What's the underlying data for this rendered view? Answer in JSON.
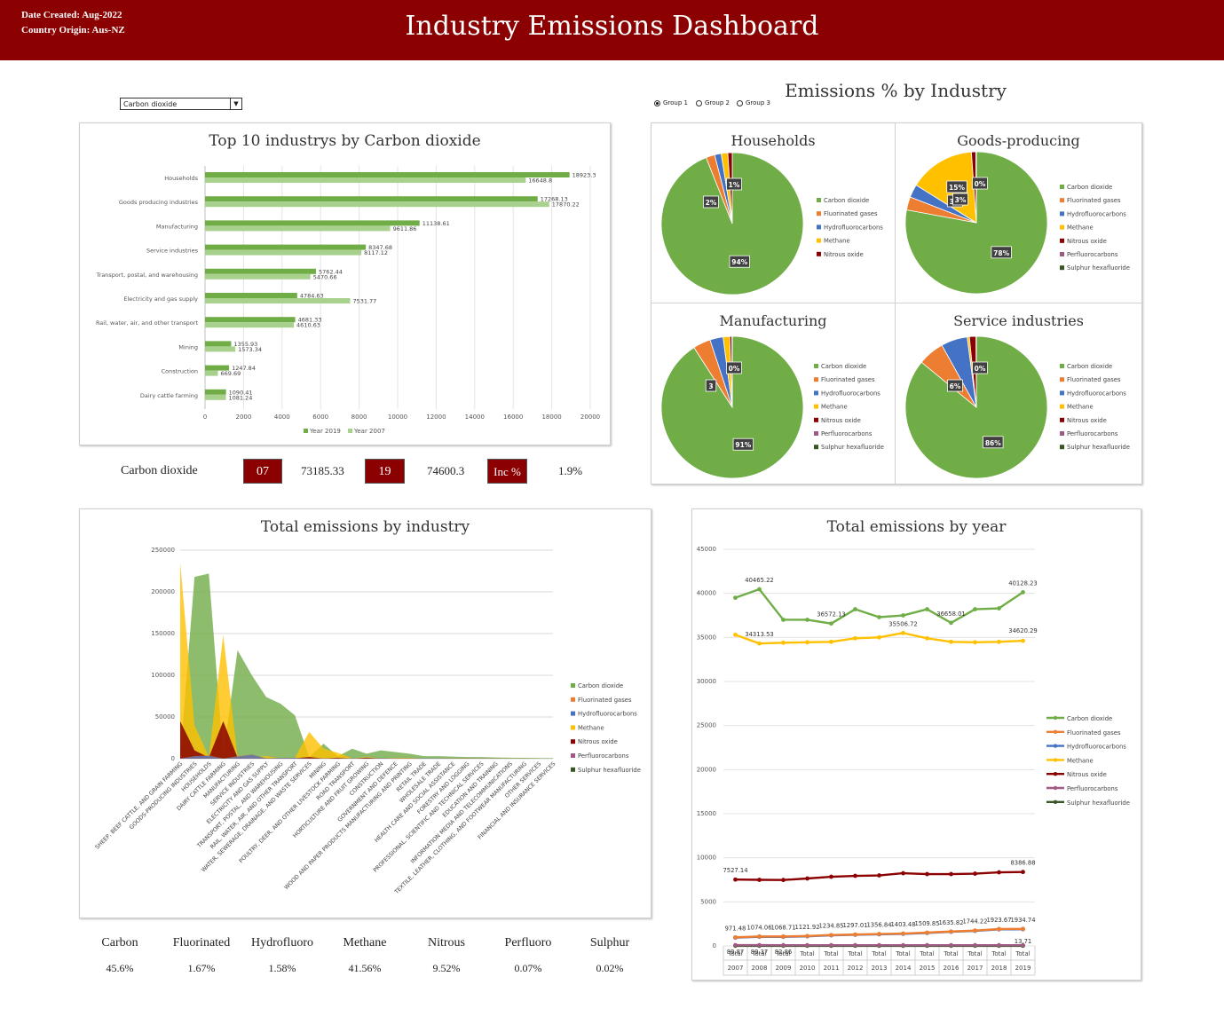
{
  "header": {
    "date_created": "Date Created: Aug-2022",
    "country_origin": "Country Origin: Aus-NZ",
    "title": "Industry Emissions Dashboard"
  },
  "controls": {
    "dropdown_value": "Carbon dioxide",
    "radio_options": [
      "Group 1",
      "Group 2",
      "Group 3"
    ],
    "radio_selected": "Group 1"
  },
  "kpi": {
    "gas": "Carbon dioxide",
    "year_a": "07",
    "value_a": "73185.33",
    "year_b": "19",
    "value_b": "74600.3",
    "inc_label": "Inc %",
    "inc_value": "1.9%"
  },
  "pie_section_title": "Emissions % by Industry",
  "gas_shares": [
    {
      "label": "Carbon",
      "value": "45.6%"
    },
    {
      "label": "Fluorinated",
      "value": "1.67%"
    },
    {
      "label": "Hydrofluoro",
      "value": "1.58%"
    },
    {
      "label": "Methane",
      "value": "41.56%"
    },
    {
      "label": "Nitrous",
      "value": "9.52%"
    },
    {
      "label": "Perfluoro",
      "value": "0.07%"
    },
    {
      "label": "Sulphur",
      "value": "0.02%"
    }
  ],
  "colors": {
    "carbon": "#70ad47",
    "fluorinated": "#ed7d31",
    "hydrofluoro": "#4472c4",
    "methane": "#ffc000",
    "nitrous": "#8b0000",
    "perfluoro": "#9e5a82",
    "sulphur": "#375623",
    "bar2007": "#a9d18e",
    "brand": "#8b0000"
  },
  "chart_data": [
    {
      "type": "bar",
      "title": "Top 10 industrys by Carbon dioxide",
      "categories": [
        "Households",
        "Goods producing industries",
        "Manufacturing",
        "Service industries",
        "Transport, postal, and warehousing",
        "Electricity and gas supply",
        "Rail, water, air, and other transport",
        "Mining",
        "Construction",
        "Dairy cattle farming"
      ],
      "series": [
        {
          "name": "Year 2019",
          "values": [
            18923.3,
            17268.13,
            11138.61,
            8347.68,
            5762.44,
            4784.63,
            4681.33,
            1355.93,
            1247.84,
            1090.41
          ],
          "labels": [
            "18923.3",
            "17268.13",
            "11138.61",
            "8347.68",
            "5762.44",
            "4784.63",
            "4681.33",
            "1355.93",
            "1247.84",
            "1090.41"
          ]
        },
        {
          "name": "Year 2007",
          "values": [
            16648.8,
            17870.22,
            9611.86,
            8117.12,
            5470.66,
            7531.77,
            4610.63,
            1573.34,
            669.69,
            1081.24
          ],
          "labels": [
            "16648.8",
            "17870.22",
            "9611.86",
            "8117.12",
            "5470.66",
            "7531.77",
            "4610.63",
            "1573.34",
            "669.69",
            "1081.24"
          ]
        }
      ],
      "xlim": [
        0,
        20000
      ],
      "xticks": [
        "0",
        "2000",
        "4000",
        "6000",
        "8000",
        "10000",
        "12000",
        "14000",
        "16000",
        "18000",
        "20000"
      ],
      "legend": "bottom"
    },
    {
      "type": "pie",
      "title": "Households",
      "slices": [
        {
          "name": "Carbon dioxide",
          "value": 94,
          "label": "94%"
        },
        {
          "name": "Fluorinated gases",
          "value": 2,
          "label": "2%"
        },
        {
          "name": "Hydrofluorocarbons",
          "value": 1.5,
          "label": ""
        },
        {
          "name": "Methane",
          "value": 1.5,
          "label": "1%"
        },
        {
          "name": "Nitrous oxide",
          "value": 1,
          "label": ""
        }
      ],
      "legend": "right"
    },
    {
      "type": "pie",
      "title": "Goods-producing",
      "slices": [
        {
          "name": "Carbon dioxide",
          "value": 78,
          "label": "78%"
        },
        {
          "name": "Fluorinated gases",
          "value": 3,
          "label": "3%"
        },
        {
          "name": "Hydrofluorocarbons",
          "value": 3,
          "label": "3%"
        },
        {
          "name": "Methane",
          "value": 15,
          "label": "15%"
        },
        {
          "name": "Nitrous oxide",
          "value": 1,
          "label": "0%"
        },
        {
          "name": "Perfluorocarbons",
          "value": 0.1,
          "label": ""
        },
        {
          "name": "Sulphur hexafluoride",
          "value": 0.02,
          "label": ""
        }
      ],
      "legend": "right"
    },
    {
      "type": "pie",
      "title": "Manufacturing",
      "slices": [
        {
          "name": "Carbon dioxide",
          "value": 91,
          "label": "91%"
        },
        {
          "name": "Fluorinated gases",
          "value": 4,
          "label": "3"
        },
        {
          "name": "Hydrofluorocarbons",
          "value": 3,
          "label": ""
        },
        {
          "name": "Methane",
          "value": 1.5,
          "label": "0%"
        },
        {
          "name": "Nitrous oxide",
          "value": 0.5,
          "label": ""
        },
        {
          "name": "Perfluorocarbons",
          "value": 0.05,
          "label": ""
        },
        {
          "name": "Sulphur hexafluoride",
          "value": 0.02,
          "label": ""
        }
      ],
      "legend": "right"
    },
    {
      "type": "pie",
      "title": "Service industries",
      "slices": [
        {
          "name": "Carbon dioxide",
          "value": 86,
          "label": "86%"
        },
        {
          "name": "Fluorinated gases",
          "value": 6,
          "label": "6%"
        },
        {
          "name": "Hydrofluorocarbons",
          "value": 6,
          "label": ""
        },
        {
          "name": "Methane",
          "value": 0.5,
          "label": ""
        },
        {
          "name": "Nitrous oxide",
          "value": 1.5,
          "label": "0%"
        },
        {
          "name": "Perfluorocarbons",
          "value": 0.05,
          "label": ""
        },
        {
          "name": "Sulphur hexafluoride",
          "value": 0.02,
          "label": ""
        }
      ],
      "legend": "right"
    },
    {
      "type": "area",
      "title": "Total emissions by industry",
      "categories": [
        "SHEEP, BEEF CATTLE, AND GRAIN FARMING",
        "GOODS-PRODUCING INDUSTRIES",
        "HOUSEHOLDS",
        "DAIRY CATTLE FARMING",
        "MANUFACTURING",
        "SERVICE INDUSTRIES",
        "ELECTRICITY AND GAS SUPPLY",
        "TRANSPORT, POSTAL, AND WAREHOUSING",
        "RAIL, WATER, AIR, AND OTHER TRANSPORT",
        "WATER, SEWERAGE, DRAINAGE, AND WASTE SERVICES",
        "MINING",
        "POULTRY, DEER, AND OTHER LIVESTOCK FARMING",
        "ROAD TRANSPORT",
        "HORTICULTURE AND FRUIT GROWING",
        "CONSTRUCTION",
        "GOVERNMENT AND DEFENCE",
        "WOOD AND PAPER PRODUCTS MANUFACTURING AND PRINTING",
        "RETAIL TRADE",
        "WHOLESALE TRADE",
        "HEALTH CARE AND SOCIAL ASSISTANCE",
        "FORESTRY AND LOGGING",
        "PROFESSIONAL, SCIENTIFIC AND TECHNICAL SERVICES",
        "EDUCATION AND TRAINING",
        "INFORMATION MEDIA AND TELECOMMUNICATIONS",
        "TEXTILE, LEATHER, CLOTHING, AND FOOTWEAR MANUFACTURING",
        "OTHER SERVICES",
        "FINANCIAL AND INSURANCE SERVICES"
      ],
      "series": [
        {
          "name": "Carbon dioxide",
          "values": [
            2000,
            218000,
            222000,
            3000,
            130000,
            100000,
            74000,
            66000,
            52000,
            2000,
            18000,
            3000,
            12000,
            6000,
            10000,
            8000,
            6000,
            3000,
            3000,
            2500,
            2000,
            2000,
            1500,
            1200,
            1000,
            800,
            600
          ]
        },
        {
          "name": "Fluorinated gases",
          "values": [
            100,
            3000,
            4000,
            100,
            3000,
            5000,
            500,
            1000,
            1000,
            200,
            500,
            100,
            600,
            200,
            800,
            400,
            300,
            500,
            400,
            300,
            100,
            200,
            150,
            150,
            100,
            100,
            80
          ]
        },
        {
          "name": "Hydrofluorocarbons",
          "values": [
            100,
            3000,
            3500,
            100,
            2500,
            4800,
            400,
            900,
            900,
            200,
            400,
            100,
            500,
            200,
            700,
            400,
            300,
            500,
            400,
            300,
            100,
            200,
            150,
            150,
            100,
            100,
            80
          ]
        },
        {
          "name": "Methane",
          "values": [
            235000,
            40000,
            2000,
            148000,
            2000,
            1500,
            3000,
            500,
            1000,
            32000,
            12000,
            7000,
            500,
            2000,
            500,
            1000,
            1000,
            300,
            300,
            200,
            400,
            200,
            150,
            100,
            100,
            100,
            50
          ]
        },
        {
          "name": "Nitrous oxide",
          "values": [
            45000,
            10000,
            1500,
            45000,
            1500,
            800,
            500,
            300,
            500,
            2000,
            300,
            1000,
            300,
            1200,
            200,
            300,
            300,
            100,
            100,
            100,
            200,
            100,
            80,
            50,
            50,
            50,
            30
          ]
        },
        {
          "name": "Perfluorocarbons",
          "values": [
            0,
            200,
            0,
            0,
            200,
            0,
            0,
            0,
            0,
            0,
            0,
            0,
            0,
            0,
            0,
            0,
            0,
            0,
            0,
            0,
            0,
            0,
            0,
            0,
            0,
            0,
            0
          ]
        },
        {
          "name": "Sulphur hexafluoride",
          "values": [
            0,
            50,
            0,
            0,
            30,
            0,
            100,
            0,
            0,
            0,
            0,
            0,
            0,
            0,
            0,
            0,
            0,
            0,
            0,
            0,
            0,
            0,
            0,
            0,
            0,
            0,
            0
          ]
        }
      ],
      "ylim": [
        0,
        250000
      ],
      "yticks": [
        "0",
        "50000",
        "100000",
        "150000",
        "200000",
        "250000"
      ],
      "legend": "right"
    },
    {
      "type": "line",
      "title": "Total emissions by year",
      "x_top": "Total",
      "categories": [
        "2007",
        "2008",
        "2009",
        "2010",
        "2011",
        "2012",
        "2013",
        "2014",
        "2015",
        "2016",
        "2017",
        "2018",
        "2019"
      ],
      "series": [
        {
          "name": "Carbon dioxide",
          "values": [
            39500,
            40465.22,
            37000,
            37000,
            36572.13,
            38200,
            37300,
            37500,
            38200,
            36658.01,
            38200,
            38300,
            40128.23
          ]
        },
        {
          "name": "Fluorinated gases",
          "values": [
            971.48,
            1074.06,
            1068.71,
            1121.92,
            1234.85,
            1297.01,
            1356.84,
            1403.48,
            1509.85,
            1635.82,
            1744.22,
            1923.67,
            1934.74
          ]
        },
        {
          "name": "Hydrofluorocarbons",
          "values": [
            940,
            1040,
            1030,
            1090,
            1200,
            1260,
            1320,
            1370,
            1470,
            1600,
            1700,
            1880,
            1890
          ]
        },
        {
          "name": "Methane",
          "values": [
            35300,
            34313.53,
            34400,
            34450,
            34500,
            34900,
            35000,
            35506.72,
            34900,
            34500,
            34450,
            34500,
            34620.29
          ]
        },
        {
          "name": "Nitrous oxide",
          "values": [
            7527.14,
            7500,
            7480,
            7650,
            7850,
            7950,
            8000,
            8250,
            8150,
            8150,
            8200,
            8350,
            8386.88
          ]
        },
        {
          "name": "Perfluorocarbons",
          "values": [
            89.87,
            89.37,
            82.86,
            82.86,
            82.8,
            82.7,
            82.6,
            82.5,
            82.4,
            82.3,
            82.2,
            82.1,
            82.0
          ]
        },
        {
          "name": "Sulphur hexafluoride",
          "values": [
            13.71,
            13.71,
            13.71,
            13.71,
            13.71,
            13.71,
            13.71,
            13.71,
            13.71,
            13.71,
            13.71,
            13.71,
            13.71
          ]
        }
      ],
      "point_labels": [
        {
          "series": "Carbon dioxide",
          "index": 1,
          "text": "40465.22"
        },
        {
          "series": "Carbon dioxide",
          "index": 4,
          "text": "36572.13"
        },
        {
          "series": "Carbon dioxide",
          "index": 9,
          "text": "36658.01"
        },
        {
          "series": "Carbon dioxide",
          "index": 12,
          "text": "40128.23"
        },
        {
          "series": "Methane",
          "index": 1,
          "text": "34313.53"
        },
        {
          "series": "Methane",
          "index": 7,
          "text": "35506.72"
        },
        {
          "series": "Methane",
          "index": 12,
          "text": "34620.29"
        },
        {
          "series": "Nitrous oxide",
          "index": 0,
          "text": "7527.14"
        },
        {
          "series": "Nitrous oxide",
          "index": 12,
          "text": "8386.88"
        },
        {
          "series": "Fluorinated gases",
          "index": 0,
          "text": "971.48"
        },
        {
          "series": "Fluorinated gases",
          "index": 1,
          "text": "1074.06"
        },
        {
          "series": "Fluorinated gases",
          "index": 2,
          "text": "1068.71"
        },
        {
          "series": "Fluorinated gases",
          "index": 3,
          "text": "1121.92"
        },
        {
          "series": "Fluorinated gases",
          "index": 4,
          "text": "1234.85"
        },
        {
          "series": "Fluorinated gases",
          "index": 5,
          "text": "1297.01"
        },
        {
          "series": "Fluorinated gases",
          "index": 6,
          "text": "1356.84"
        },
        {
          "series": "Fluorinated gases",
          "index": 7,
          "text": "1403.48"
        },
        {
          "series": "Fluorinated gases",
          "index": 8,
          "text": "1509.85"
        },
        {
          "series": "Fluorinated gases",
          "index": 9,
          "text": "1635.82"
        },
        {
          "series": "Fluorinated gases",
          "index": 10,
          "text": "1744.22"
        },
        {
          "series": "Fluorinated gases",
          "index": 11,
          "text": "1923.67"
        },
        {
          "series": "Fluorinated gases",
          "index": 12,
          "text": "1934.74"
        },
        {
          "series": "Perfluorocarbons",
          "index": 0,
          "text": "89.87"
        },
        {
          "series": "Perfluorocarbons",
          "index": 1,
          "text": "89.37"
        },
        {
          "series": "Perfluorocarbons",
          "index": 2,
          "text": "82.86"
        },
        {
          "series": "Sulphur hexafluoride",
          "index": 12,
          "text": "13.71"
        }
      ],
      "ylim": [
        0,
        45000
      ],
      "yticks": [
        "0",
        "5000",
        "10000",
        "15000",
        "20000",
        "25000",
        "30000",
        "35000",
        "40000",
        "45000"
      ],
      "legend": "right"
    }
  ]
}
